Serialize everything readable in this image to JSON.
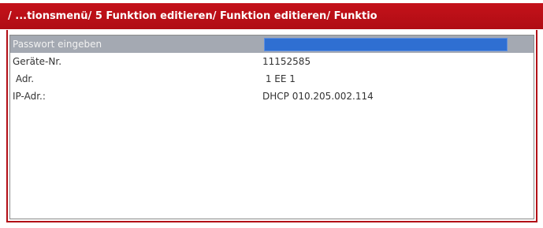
{
  "title": "/ ...tionsmenü/ 5 Funktion editieren/ Funktion editieren/ Funktio",
  "rows": [
    {
      "label": "Passwort eingeben",
      "value": ""
    },
    {
      "label": "Geräte-Nr.",
      "value": "11152585"
    },
    {
      "label": " Adr.",
      "value": " 1 EE 1"
    },
    {
      "label": "IP-Adr.:",
      "value": "DHCP 010.205.002.114"
    }
  ],
  "colors": {
    "title_bar": "#c4121a",
    "selected_row": "#a4a9b2",
    "password_field": "#2f6fd2"
  }
}
